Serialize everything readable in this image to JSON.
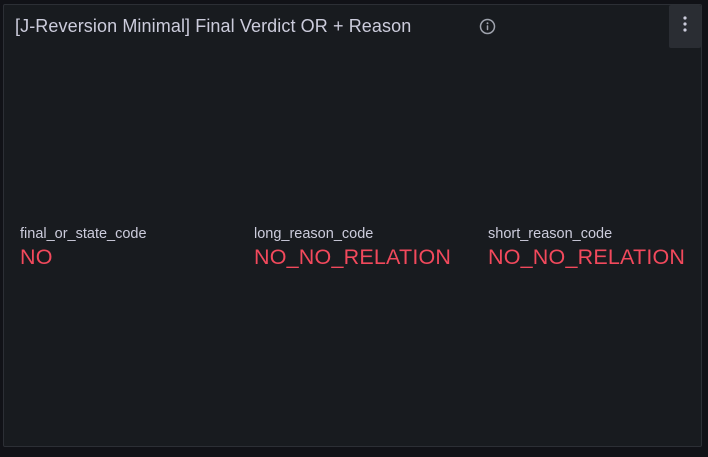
{
  "panel": {
    "title": "[J-Reversion Minimal] Final Verdict OR + Reason",
    "info_icon": "info-circle-icon",
    "menu_icon": "kebab-menu-icon"
  },
  "stats": [
    {
      "name": "final_or_state_code",
      "value": "NO"
    },
    {
      "name": "long_reason_code",
      "value": "NO_NO_RELATION"
    },
    {
      "name": "short_reason_code",
      "value": "NO_NO_RELATION"
    }
  ],
  "colors": {
    "background": "#181b1f",
    "title_text": "#ccccdc",
    "value_red": "#f2495c"
  }
}
